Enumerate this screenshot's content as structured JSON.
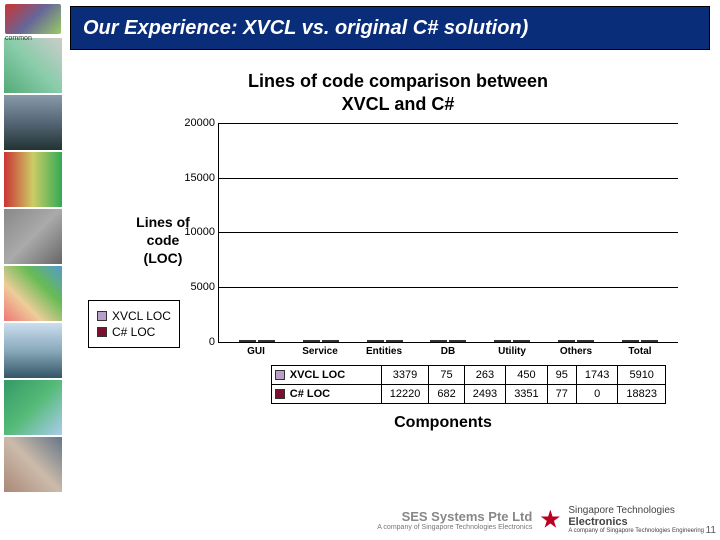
{
  "header": {
    "title": "Our Experience: XVCL vs. original C# solution)"
  },
  "chart_data": {
    "type": "bar",
    "title": "Lines of code comparison between\nXVCL and C#",
    "xlabel": "Components",
    "ylabel": "Lines of code\n(LOC)",
    "ylim": [
      0,
      20000
    ],
    "yticks": [
      0,
      5000,
      10000,
      15000,
      20000
    ],
    "categories": [
      "GUI",
      "Service",
      "Entities",
      "DB",
      "Utility",
      "Others",
      "Total"
    ],
    "series": [
      {
        "name": "XVCL LOC",
        "color": "#b9a0c9",
        "values": [
          3379,
          75,
          263,
          450,
          95,
          1743,
          5910
        ]
      },
      {
        "name": "C# LOC",
        "color": "#7b1030",
        "values": [
          12220,
          682,
          2493,
          3351,
          77,
          0,
          18823
        ]
      }
    ]
  },
  "footer": {
    "company1": "SES Systems Pte Ltd",
    "company1_sub": "A company of Singapore Technologies Electronics",
    "company2": "Singapore Technologies",
    "company2b": "Electronics",
    "company2_sub": "A company of Singapore Technologies Engineering"
  },
  "page_number": "11"
}
